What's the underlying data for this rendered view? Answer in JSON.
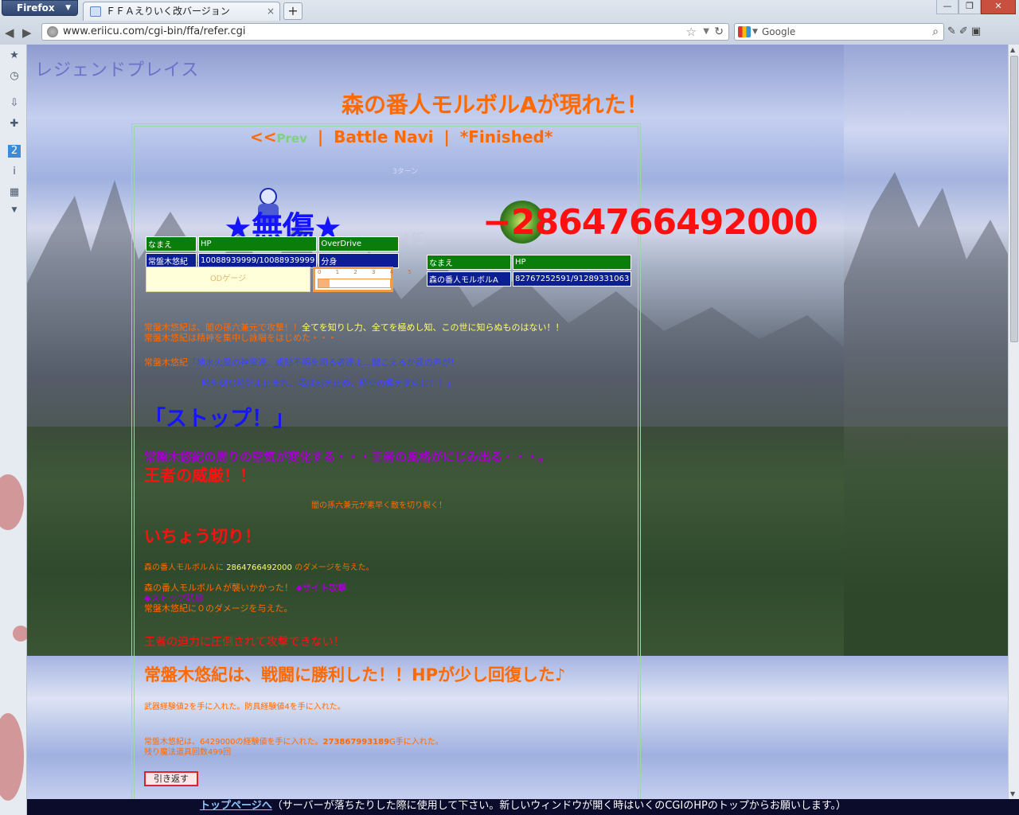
{
  "browser": {
    "app_menu": "Firefox",
    "tab_title": "ＦＦＡえりいく改バージョン",
    "url": "www.eriicu.com/cgi-bin/ffa/refer.cgi",
    "search_engine": "Google",
    "search_placeholder": "Google"
  },
  "page": {
    "place_title": "レジェンドプレイス",
    "appear_message": "森の番人モルボルAが現れた！",
    "nav": {
      "prev_arrows": "<<",
      "prev": "Prev",
      "sep": "|",
      "battle_navi": "Battle Navi",
      "finished": "*Finished*"
    },
    "turn_label": "3ターン",
    "no_damage": "★無傷★",
    "vs": "VS",
    "damage_display": "−2864766492000",
    "player": {
      "headers": {
        "name": "なまえ",
        "hp": "HP",
        "overdrive": "OverDrive"
      },
      "name": "常盤木悠紀",
      "hp": "10088939999/10088939999",
      "overdrive_state": "分身",
      "od_gauge_label": "ODゲージ",
      "od_scale": "0 1 2 3 4 5",
      "od_level": 0.15
    },
    "enemy": {
      "headers": {
        "name": "なまえ",
        "hp": "HP"
      },
      "name": "森の番人モルボルA",
      "hp": "82767252591/91289331063"
    },
    "log": {
      "attack_line_a": "常盤木悠紀は、闇の孫六兼元で攻撃！！",
      "attack_line_b": "全てを知りし力、全てを極めし知、この世に知らぬものはない！！",
      "chant_line": "常盤木悠紀は精神を集中し詠唱をはじめた・・・",
      "spell_speaker": "常盤木悠紀",
      "spell_line1": "「地水火風の神霊達、成陰不明を司る者達よ…聞こえるか我の声が！",
      "spell_line2": "時を刻む時計よ止まれ、我は刻を止め、時空の檻を此処に！！」",
      "stop_name": "「ストップ！」",
      "aura_line": "常盤木悠紀の周りの空気が変化する・・・王者の風格がにじみ出る・・・。",
      "majesty": "王者の威厳！！",
      "weapon_cut": "闇の孫六兼元が素早く敵を切り裂く！",
      "ichou": "いちょう切り！",
      "damage_line_pre": "森の番人モルボルＡに",
      "damage_value": "2864766492000",
      "damage_line_post": "のダメージを与えた。",
      "enemy_attack": "森の番人モルボルＡが襲いかかった！",
      "sight_attack": "◆サイト攻撃",
      "stop_state": "◆ストップ状態",
      "zero_damage": "常盤木悠紀に０のダメージを与えた。",
      "overwhelmed": "王者の迫力に圧倒されて攻撃できない！",
      "victory": "常盤木悠紀は、戦闘に勝利した！！HPが少し回復した♪",
      "exp_weapon": "武器経験値2を手に入れた。防具経験値4を手に入れた。",
      "reward_pre": "常盤木悠紀は、6429000の経験値を手に入れた。",
      "gold_value": "273867993189",
      "reward_post": "G手に入れた。",
      "magic_left": "残り魔法道具回数499回",
      "return_button": "引き返す"
    },
    "footer": {
      "top_link": "トップページへ",
      "note": "（サーバーが落ちたりした際に使用して下さい。新しいウィンドウが開く時はいくのCGIのHPのトップからお願いします。）"
    }
  }
}
